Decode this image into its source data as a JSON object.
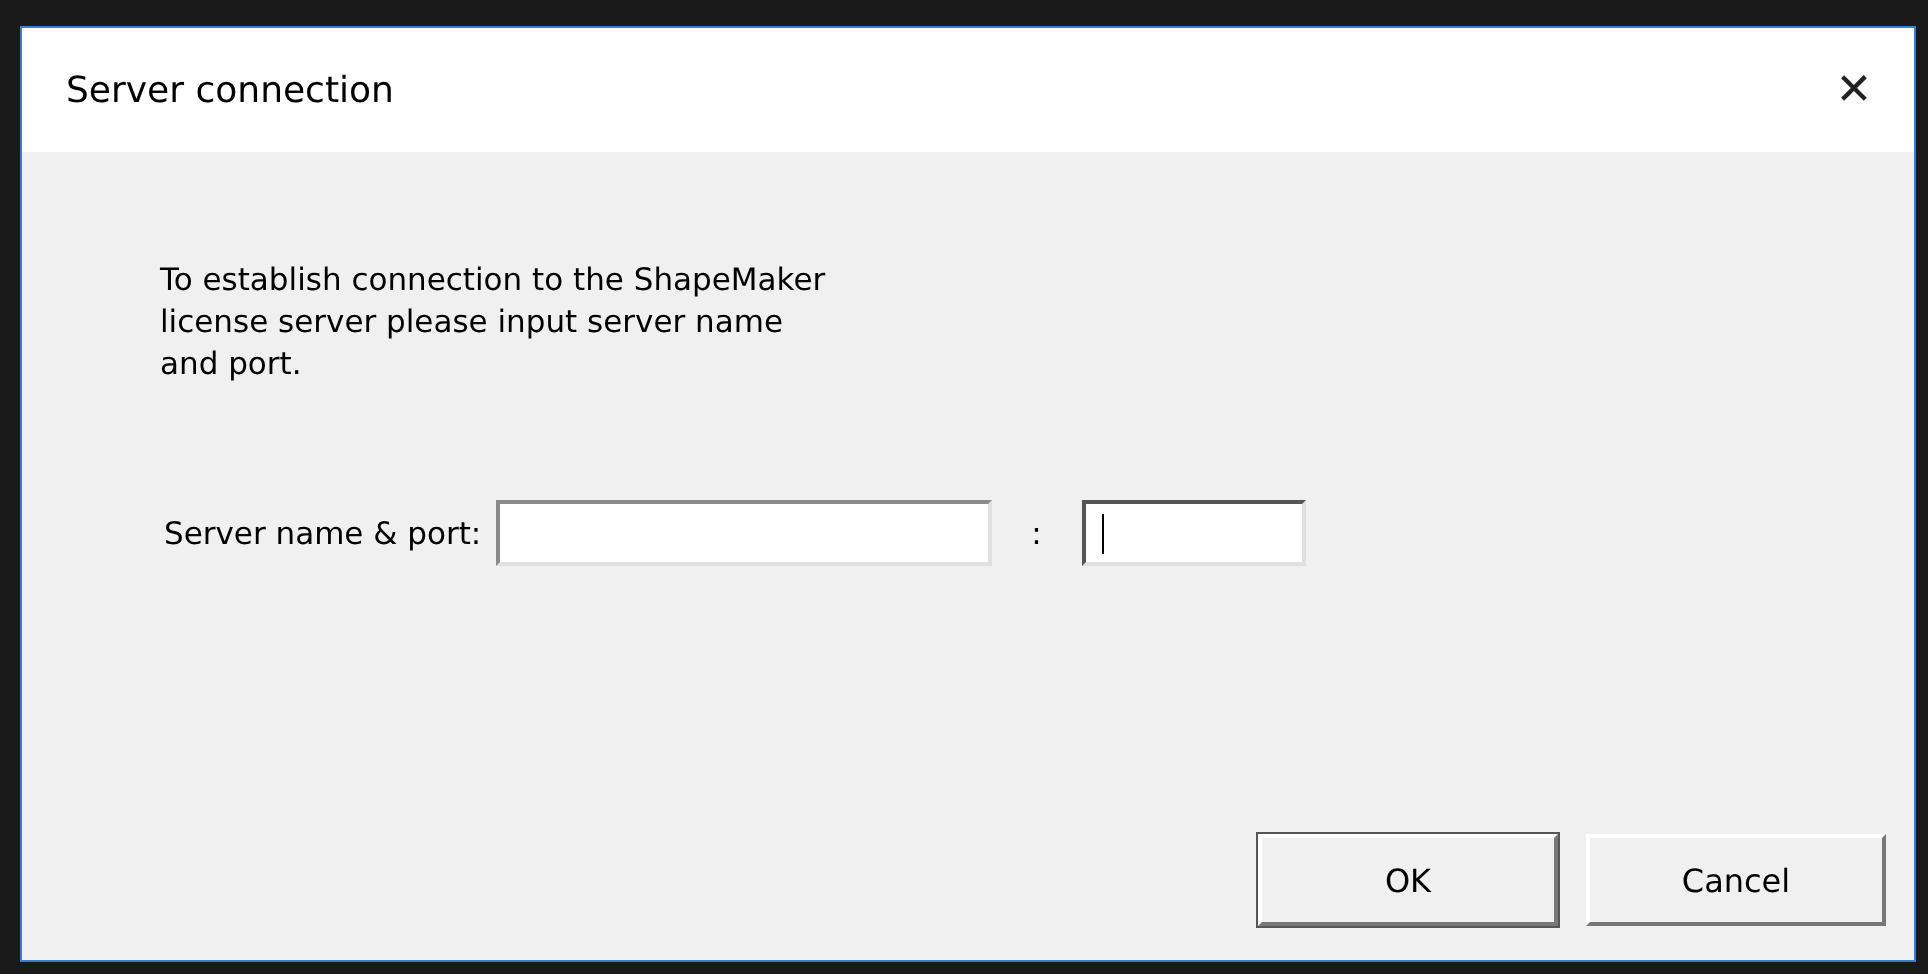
{
  "window": {
    "title": "Server connection",
    "close": "✕"
  },
  "message": "To establish connection to the ShapeMaker license server please input server name and port.",
  "server": {
    "label": "Server name & port:",
    "separator": ":",
    "fields": [
      {
        "kind": "name",
        "focused": false
      },
      {
        "kind": "port",
        "focused": true
      }
    ]
  },
  "buttons": [
    {
      "label": "OK",
      "default": true
    },
    {
      "label": "Cancel",
      "default": false
    }
  ]
}
